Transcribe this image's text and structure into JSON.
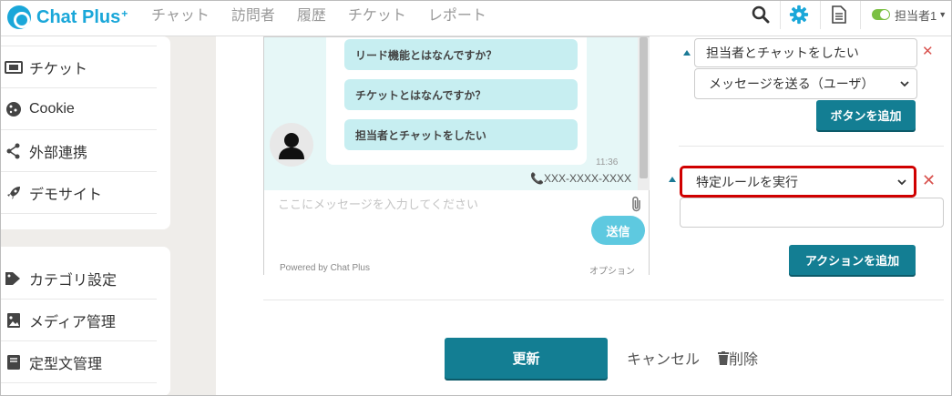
{
  "brand": {
    "name": "Chat Plus",
    "sup": "+",
    "color": "#1aa7d9"
  },
  "nav": {
    "items": [
      "チャット",
      "訪問者",
      "履歴",
      "チケット",
      "レポート"
    ]
  },
  "user": {
    "name": "担当者1",
    "status_color": "#7bc043"
  },
  "icons": {
    "search": "search-icon",
    "settings": "gear-icon",
    "doc": "document-icon"
  },
  "sidebar": {
    "group1": [
      {
        "label": "チケット",
        "icon": "ticket-icon"
      },
      {
        "label": "Cookie",
        "icon": "cookie-icon"
      },
      {
        "label": "外部連携",
        "icon": "share-icon"
      },
      {
        "label": "デモサイト",
        "icon": "rocket-icon"
      }
    ],
    "group2": [
      {
        "label": "カテゴリ設定",
        "icon": "tag-icon"
      },
      {
        "label": "メディア管理",
        "icon": "image-icon"
      },
      {
        "label": "定型文管理",
        "icon": "book-icon"
      }
    ]
  },
  "preview": {
    "questions": [
      "リード機能とはなんですか？",
      "チケットとはなんですか？",
      "担当者とチャットをしたい"
    ],
    "time": "11:36",
    "phone": "XXX-XXXX-XXXX",
    "input_placeholder": "ここにメッセージを入力してください",
    "send": "送信",
    "powered_by": "Powered by Chat Plus",
    "option": "オプション"
  },
  "editor": {
    "button_text_value": "担当者とチャットをしたい",
    "action_select": "メッセージを送る（ユーザ）",
    "add_button": "ボタンを追加",
    "rule_select": "特定ルールを実行",
    "rule_value": "",
    "add_action": "アクションを追加"
  },
  "footer": {
    "update": "更新",
    "cancel": "キャンセル",
    "delete": "削除"
  },
  "colors": {
    "accent": "#137e93",
    "danger": "#d9534f",
    "highlight": "#d00000",
    "chat_bg": "#e6f7f7",
    "question_bg": "#c7eef1"
  }
}
